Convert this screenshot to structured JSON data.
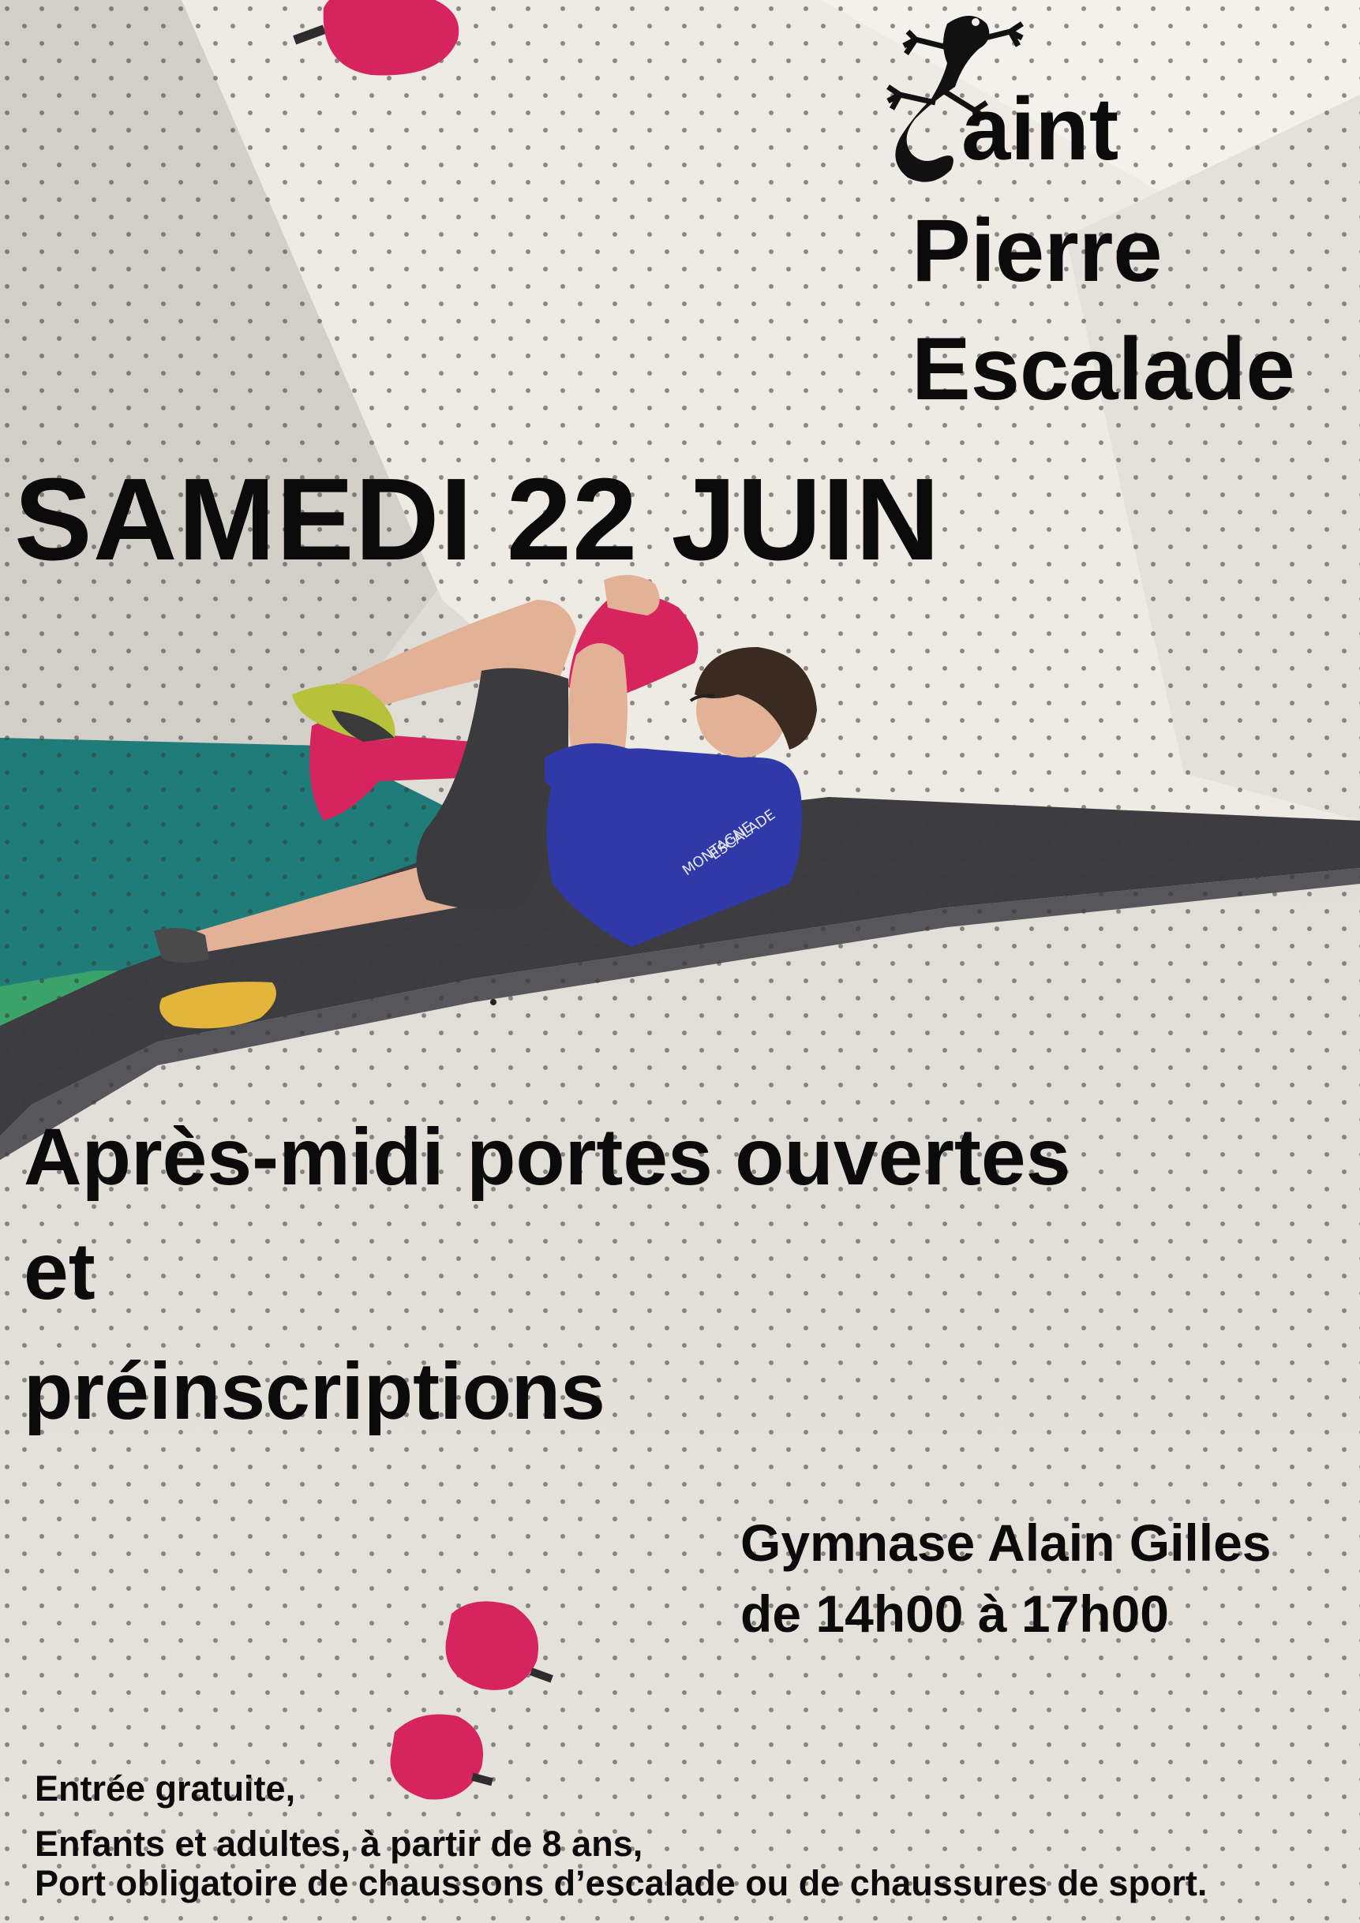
{
  "logo": {
    "icon": "gecko-icon",
    "line1": "aint",
    "line2": "Pierre",
    "line3": "Escalade"
  },
  "event": {
    "date": "SAMEDI 22 JUIN",
    "title_lines": [
      "Après-midi portes ouvertes",
      "et",
      "préinscriptions"
    ]
  },
  "venue": {
    "name": "Gymnase Alain Gilles",
    "hours": "de 14h00 à 17h00"
  },
  "info": {
    "lines": [
      "Entrée gratuite,",
      "Enfants et adultes, à partir de 8 ans,",
      "Port obligatoire de chaussons d’escalade ou de chaussures de sport."
    ]
  },
  "photo": {
    "subject": "climber-photo",
    "shirt_print": "MONTAGNE ESCALADE"
  },
  "colors": {
    "text": "#0b0b0b",
    "wall_light": "#eeeae4",
    "wall_shadow": "#cfcbc6",
    "panel_teal": "#1f7c78",
    "volume_grey": "#3d3c40",
    "hold_pink": "#d6245e",
    "hold_yellow": "#e3b53a",
    "shirt_blue": "#2f3aa8",
    "shorts_grey": "#3b3b3d",
    "skin": "#e3b296",
    "hair": "#3a2a1f"
  }
}
